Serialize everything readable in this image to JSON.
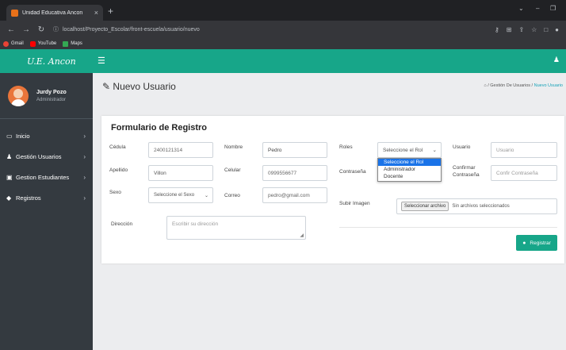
{
  "browser": {
    "tab_title": "Unidad Educativa Ancon",
    "tab_close": "×",
    "new_tab": "+",
    "url": "localhost/Proyecto_Escolar/front-escuela/usuario/nuevo",
    "bookmarks": [
      {
        "label": "Gmail",
        "color": "#ea4335"
      },
      {
        "label": "YouTube",
        "color": "#ff0000"
      },
      {
        "label": "Maps",
        "color": "#34a853"
      }
    ]
  },
  "app": {
    "brand": "U.E. Ancon",
    "user_name": "Jurdy Pozo",
    "user_role": "Administrador",
    "menu": [
      {
        "label": "Inicio",
        "icon": "desktop-icon"
      },
      {
        "label": "Gestión Usuarios",
        "icon": "user-icon"
      },
      {
        "label": "Gestion Estudiantes",
        "icon": "id-card-icon"
      },
      {
        "label": "Registros",
        "icon": "tag-icon"
      }
    ],
    "accent": "#17a689",
    "sidebar_bg": "#343a40"
  },
  "page": {
    "title": "Nuevo Usuario",
    "breadcrumb_1": "Gestión De Usuarios",
    "breadcrumb_sep": "/",
    "breadcrumb_2": "Nuevo Usuario"
  },
  "form": {
    "title": "Formulario de Registro",
    "cedula_label": "Cédula",
    "cedula_value": "2400121314",
    "nombre_label": "Nombre",
    "nombre_value": "Pedro",
    "roles_label": "Roles",
    "roles_selected": "Seleccione el Rol",
    "roles_options": [
      "Seleccione el Rol",
      "Administrador",
      "Docente"
    ],
    "usuario_label": "Usuario",
    "usuario_placeholder": "Usuario",
    "apellido_label": "Apellido",
    "apellido_value": "Villon",
    "celular_label": "Celular",
    "celular_value": "0999556677",
    "contrasena_label": "Contraseña",
    "confirmar_label_1": "Confirmar",
    "confirmar_label_2": "Contraseña",
    "confirmar_placeholder": "Confir Contraseña",
    "sexo_label": "Sexo",
    "sexo_selected": "Seleccione el Sexo",
    "correo_label": "Correo",
    "correo_value": "pedro@gmail.com",
    "imagen_label": "Subir Imagen",
    "file_button": "Seleccionar archivo",
    "file_status": "Sin archivos seleccionados",
    "direccion_label": "Dirección",
    "direccion_placeholder": "Escribir su dirección",
    "submit_label": "Registrar"
  }
}
